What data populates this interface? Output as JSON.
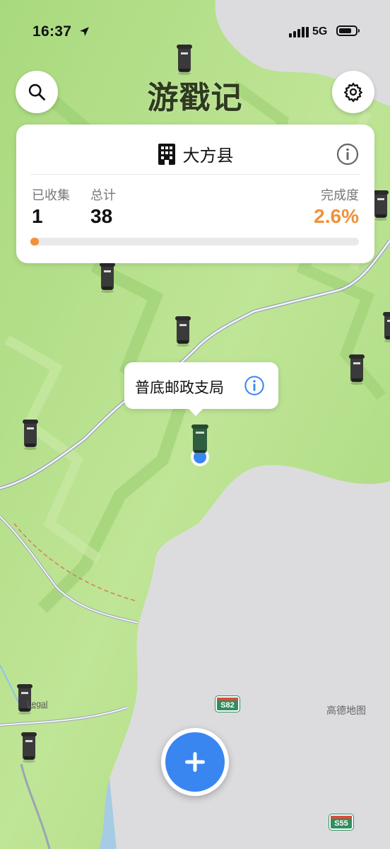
{
  "status": {
    "time": "16:37",
    "network": "5G"
  },
  "app": {
    "title": "游戳记"
  },
  "icons": {
    "search": "search-icon",
    "settings": "gear-icon",
    "location": "location-arrow-icon",
    "building": "building-icon",
    "info": "info-icon",
    "add": "plus-icon",
    "mailbox": "mailbox-icon"
  },
  "card": {
    "county": "大方县",
    "collected_label": "已收集",
    "collected_value": "1",
    "total_label": "总计",
    "total_value": "38",
    "completion_label": "完成度",
    "completion_value": "2.6%",
    "progress": 0.026
  },
  "callout": {
    "name": "普底邮政支局"
  },
  "map": {
    "legal": "Legal",
    "watermark": "高德地图",
    "highways": [
      "S82",
      "S55"
    ]
  },
  "colors": {
    "accent": "#f0913a",
    "primary_button": "#3a86f0",
    "land": "#b8e08c",
    "water": "#dcdcde"
  }
}
